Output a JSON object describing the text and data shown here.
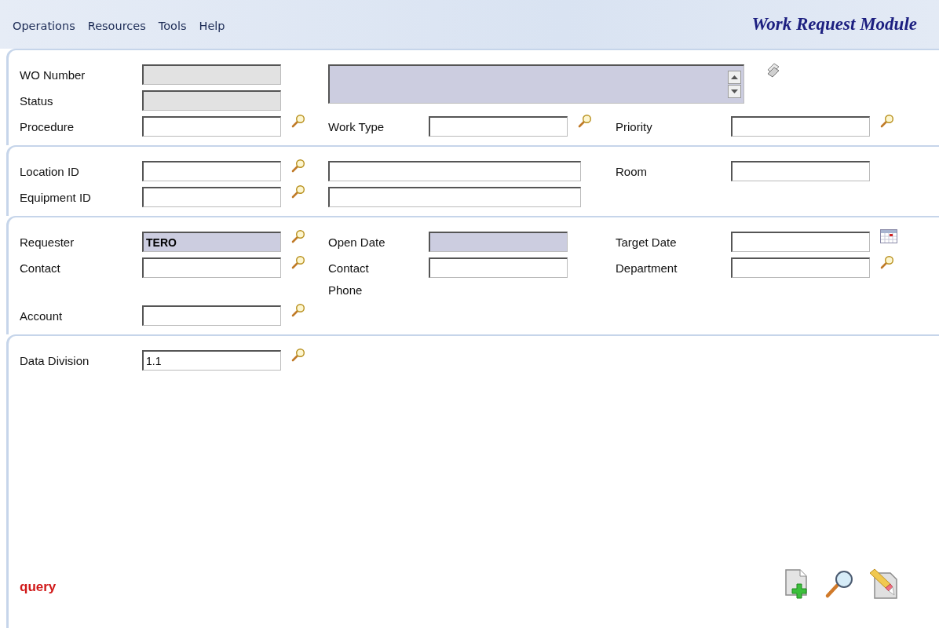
{
  "menu": [
    {
      "label": "Operations"
    },
    {
      "label": "Resources"
    },
    {
      "label": "Tools"
    },
    {
      "label": "Help"
    }
  ],
  "title": "Work Request Module",
  "sections": [
    {
      "fields": [
        {
          "kind": "field",
          "label": "WO Number",
          "disabled": true,
          "readonly": false
        },
        {
          "kind": "memo",
          "disabled": false,
          "readonly": true,
          "button": {
            "kind": "pages"
          }
        },
        {
          "kind": "field",
          "label": "Status",
          "disabled": true,
          "readonly": false
        },
        {
          "kind": "field",
          "label": "Procedure",
          "disabled": false,
          "readonly": false,
          "button": {
            "kind": "search"
          }
        },
        {
          "kind": "field",
          "label": "Work Type",
          "disabled": false,
          "readonly": false,
          "button": {
            "kind": "search"
          }
        },
        {
          "kind": "field",
          "label": "Priority",
          "disabled": false,
          "readonly": false,
          "button": {
            "kind": "search"
          }
        }
      ]
    },
    {
      "fields": [
        {
          "kind": "field",
          "label": "Location ID",
          "disabled": false,
          "readonly": false,
          "button": {
            "kind": "search"
          }
        },
        {
          "kind": "wide",
          "disabled": false,
          "readonly": false
        },
        {
          "kind": "field",
          "label": "Room",
          "disabled": false,
          "readonly": false
        },
        {
          "kind": "field",
          "label": "Equipment ID",
          "disabled": false,
          "readonly": false,
          "button": {
            "kind": "search"
          }
        },
        {
          "kind": "wide",
          "disabled": false,
          "readonly": false
        }
      ]
    },
    {
      "fields": [
        {
          "kind": "field",
          "label": "Requester",
          "disabled": false,
          "readonly": true,
          "value": "TERO",
          "button": {
            "kind": "search"
          }
        },
        {
          "kind": "field",
          "label": "Open Date",
          "disabled": false,
          "readonly": true
        },
        {
          "kind": "field",
          "label": "Target Date",
          "disabled": false,
          "readonly": false,
          "button": {
            "kind": "calendar"
          }
        },
        {
          "kind": "field",
          "label": "Contact",
          "disabled": false,
          "readonly": false,
          "button": {
            "kind": "search"
          }
        },
        {
          "kind": "field",
          "label": "Contact Phone",
          "disabled": false,
          "readonly": false
        },
        {
          "kind": "field",
          "label": "Department",
          "disabled": false,
          "readonly": false,
          "button": {
            "kind": "search"
          }
        },
        {
          "kind": "field",
          "label": "Account",
          "disabled": false,
          "readonly": false,
          "button": {
            "kind": "search"
          }
        }
      ]
    },
    {
      "fields": [
        {
          "kind": "field",
          "label": "Data Division",
          "disabled": false,
          "readonly": false,
          "value": "1.1",
          "button": {
            "kind": "search"
          }
        }
      ]
    }
  ],
  "mode": "query",
  "actions": [
    {
      "kind": "new"
    },
    {
      "kind": "search"
    },
    {
      "kind": "clear"
    }
  ]
}
